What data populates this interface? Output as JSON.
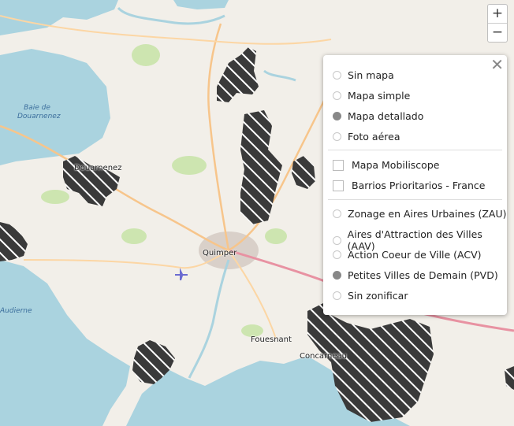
{
  "map_labels": {
    "bay": "Baie de\nDouarnenez",
    "douarnenez": "Douarnenez",
    "quimper": "Quimper",
    "audierne": "Audierne",
    "fouesnant": "Fouesnant",
    "concarneau": "Concarneau"
  },
  "zoom": {
    "in": "+",
    "out": "−"
  },
  "panel": {
    "close": "✕",
    "base_maps": [
      {
        "label": "Sin mapa",
        "selected": false
      },
      {
        "label": "Mapa simple",
        "selected": false
      },
      {
        "label": "Mapa detallado",
        "selected": true
      },
      {
        "label": "Foto aérea",
        "selected": false
      }
    ],
    "overlays": [
      {
        "label": "Mapa Mobiliscope",
        "checked": false
      },
      {
        "label": "Barrios Prioritarios - France",
        "checked": false
      }
    ],
    "zonings": [
      {
        "label": "Zonage en Aires Urbaines (ZAU)",
        "selected": false
      },
      {
        "label": "Aires d'Attraction des Villes (AAV)",
        "selected": false
      },
      {
        "label": "Action Coeur de Ville (ACV)",
        "selected": false
      },
      {
        "label": "Petites Villes de Demain (PVD)",
        "selected": true
      },
      {
        "label": "Sin zonificar",
        "selected": false
      }
    ]
  },
  "colors": {
    "sea": "#aad3df",
    "land": "#f2efe9",
    "forest": "#cde5b0",
    "road": "#f7c58b",
    "hatch": "#3a3a3a",
    "urban": "#d9d0c9"
  }
}
